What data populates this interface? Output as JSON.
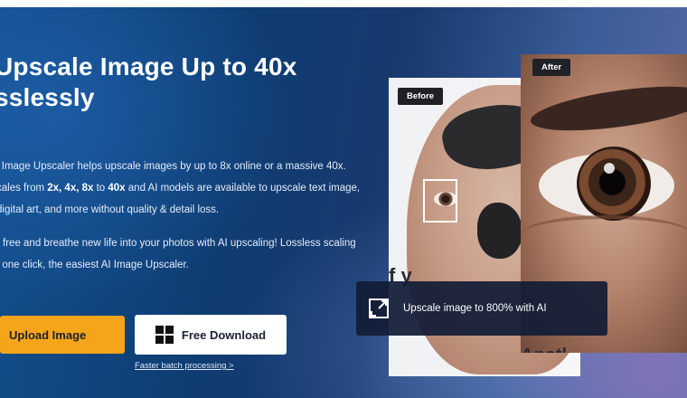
{
  "hero": {
    "title_line1": "Upscale Image Up to 40x",
    "title_line2": "sslessly",
    "description1_part1": "l Image Upscaler helps upscale images by up to 8x online or a massive 40x.",
    "description1_part2_prefix": "cales from ",
    "scales_highlight1": "2x, 4x, 8x",
    "scales_to": " to ",
    "scales_highlight2": "40x",
    "description1_part2_suffix": " and AI models are available to upscale text image,",
    "description1_part3": "digital art, and more without quality & detail loss.",
    "description2_line1": "r free and breathe new life into your photos with AI upscaling! Lossless scaling",
    "description2_line2": "t one click, the easiest AI Image Upscaler."
  },
  "buttons": {
    "upload_label": "Upload Image",
    "download_label": "Free Download",
    "batch_link": "Faster batch processing >"
  },
  "comparison": {
    "before_label": "Before",
    "after_label": "After",
    "before_word": "f y",
    "brand_text": "Apotl",
    "tooltip": "Upscale image to 800% with AI"
  },
  "colors": {
    "accent": "#f6a51a",
    "hero_bg": "#0f3c72"
  }
}
